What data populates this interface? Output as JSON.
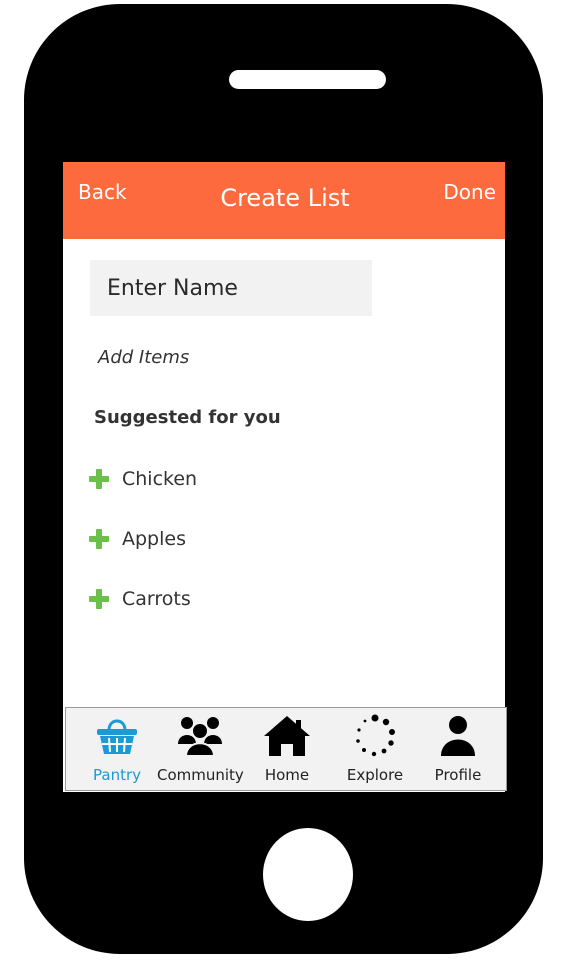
{
  "header": {
    "back_label": "Back",
    "title": "Create List",
    "done_label": "Done"
  },
  "form": {
    "name_placeholder": "Enter Name",
    "add_items_label": "Add Items"
  },
  "suggested": {
    "title": "Suggested for you",
    "items": [
      {
        "label": "Chicken"
      },
      {
        "label": "Apples"
      },
      {
        "label": "Carrots"
      }
    ]
  },
  "tabs": [
    {
      "label": "Pantry",
      "icon": "basket-icon",
      "active": true
    },
    {
      "label": "Community",
      "icon": "people-icon",
      "active": false
    },
    {
      "label": "Home",
      "icon": "house-icon",
      "active": false
    },
    {
      "label": "Explore",
      "icon": "dots-circle-icon",
      "active": false
    },
    {
      "label": "Profile",
      "icon": "person-icon",
      "active": false
    }
  ],
  "colors": {
    "header": "#fd6a3e",
    "accent": "#1b9ad6",
    "plus": "#6cc04a"
  }
}
